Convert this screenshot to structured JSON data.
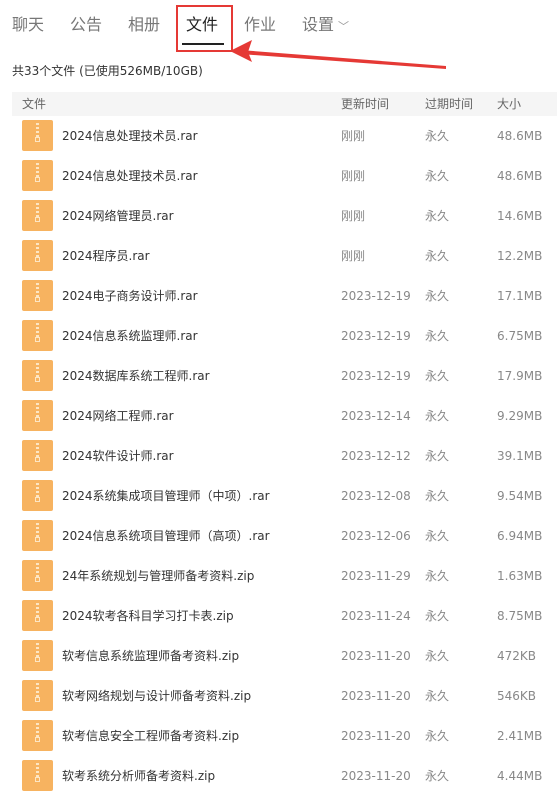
{
  "tabs": [
    {
      "label": "聊天"
    },
    {
      "label": "公告"
    },
    {
      "label": "相册"
    },
    {
      "label": "文件",
      "active": true
    },
    {
      "label": "作业"
    },
    {
      "label": "设置"
    }
  ],
  "summary": "共33个文件 (已使用526MB/10GB)",
  "columns": {
    "name": "文件",
    "updated": "更新时间",
    "expires": "过期时间",
    "size": "大小"
  },
  "files": [
    {
      "name": "2024信息处理技术员.rar",
      "updated": "刚刚",
      "expires": "永久",
      "size": "48.6MB"
    },
    {
      "name": "2024信息处理技术员.rar",
      "updated": "刚刚",
      "expires": "永久",
      "size": "48.6MB"
    },
    {
      "name": "2024网络管理员.rar",
      "updated": "刚刚",
      "expires": "永久",
      "size": "14.6MB"
    },
    {
      "name": "2024程序员.rar",
      "updated": "刚刚",
      "expires": "永久",
      "size": "12.2MB"
    },
    {
      "name": "2024电子商务设计师.rar",
      "updated": "2023-12-19",
      "expires": "永久",
      "size": "17.1MB"
    },
    {
      "name": "2024信息系统监理师.rar",
      "updated": "2023-12-19",
      "expires": "永久",
      "size": "6.75MB"
    },
    {
      "name": "2024数据库系统工程师.rar",
      "updated": "2023-12-19",
      "expires": "永久",
      "size": "17.9MB"
    },
    {
      "name": "2024网络工程师.rar",
      "updated": "2023-12-14",
      "expires": "永久",
      "size": "9.29MB"
    },
    {
      "name": "2024软件设计师.rar",
      "updated": "2023-12-12",
      "expires": "永久",
      "size": "39.1MB"
    },
    {
      "name": "2024系统集成项目管理师（中项）.rar",
      "updated": "2023-12-08",
      "expires": "永久",
      "size": "9.54MB"
    },
    {
      "name": "2024信息系统项目管理师（高项）.rar",
      "updated": "2023-12-06",
      "expires": "永久",
      "size": "6.94MB"
    },
    {
      "name": "24年系统规划与管理师备考资料.zip",
      "updated": "2023-11-29",
      "expires": "永久",
      "size": "1.63MB"
    },
    {
      "name": "2024软考各科目学习打卡表.zip",
      "updated": "2023-11-24",
      "expires": "永久",
      "size": "8.75MB"
    },
    {
      "name": "软考信息系统监理师备考资料.zip",
      "updated": "2023-11-20",
      "expires": "永久",
      "size": "472KB"
    },
    {
      "name": "软考网络规划与设计师备考资料.zip",
      "updated": "2023-11-20",
      "expires": "永久",
      "size": "546KB"
    },
    {
      "name": "软考信息安全工程师备考资料.zip",
      "updated": "2023-11-20",
      "expires": "永久",
      "size": "2.41MB"
    },
    {
      "name": "软考系统分析师备考资料.zip",
      "updated": "2023-11-20",
      "expires": "永久",
      "size": "4.44MB"
    }
  ]
}
